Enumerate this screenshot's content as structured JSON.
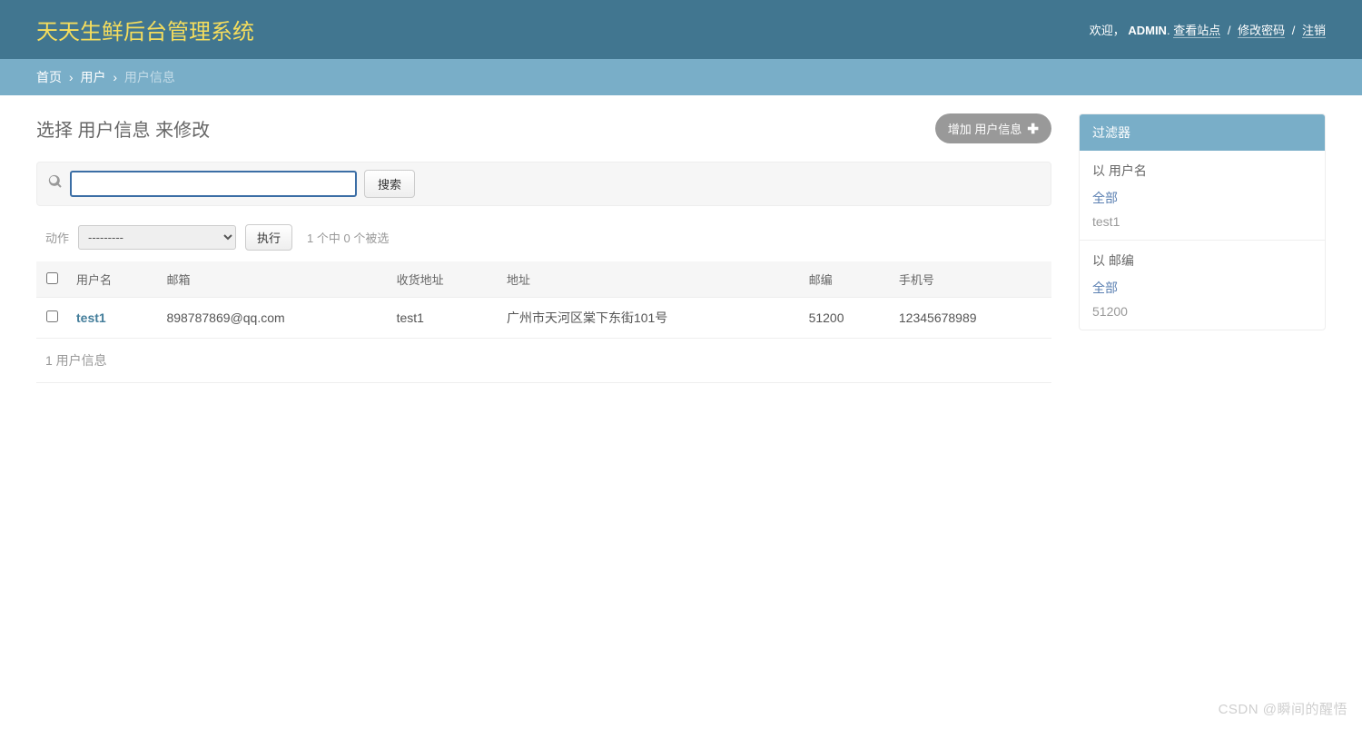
{
  "header": {
    "site_title": "天天生鲜后台管理系统",
    "welcome": "欢迎，",
    "user": "ADMIN",
    "user_suffix": ".",
    "view_site": "查看站点",
    "change_password": "修改密码",
    "logout": "注销"
  },
  "breadcrumbs": {
    "home": "首页",
    "app": "用户",
    "current": "用户信息"
  },
  "page": {
    "title": "选择 用户信息 来修改",
    "add_label": "增加 用户信息"
  },
  "search": {
    "value": "",
    "button": "搜索"
  },
  "actions": {
    "label": "动作",
    "placeholder": "---------",
    "go": "执行",
    "counter": "1 个中 0 个被选"
  },
  "table": {
    "headers": {
      "username": "用户名",
      "email": "邮箱",
      "receiver": "收货地址",
      "address": "地址",
      "zipcode": "邮编",
      "phone": "手机号"
    },
    "rows": [
      {
        "username": "test1",
        "email": "898787869@qq.com",
        "receiver": "test1",
        "address": "广州市天河区棠下东街101号",
        "zipcode": "51200",
        "phone": "12345678989"
      }
    ],
    "paginator": "1 用户信息"
  },
  "filter": {
    "title": "过滤器",
    "groups": [
      {
        "label": "以 用户名",
        "items": [
          "全部",
          "test1"
        ],
        "selected": 0
      },
      {
        "label": "以 邮编",
        "items": [
          "全部",
          "51200"
        ],
        "selected": 0
      }
    ]
  },
  "watermark": "CSDN @瞬间的醒悟"
}
